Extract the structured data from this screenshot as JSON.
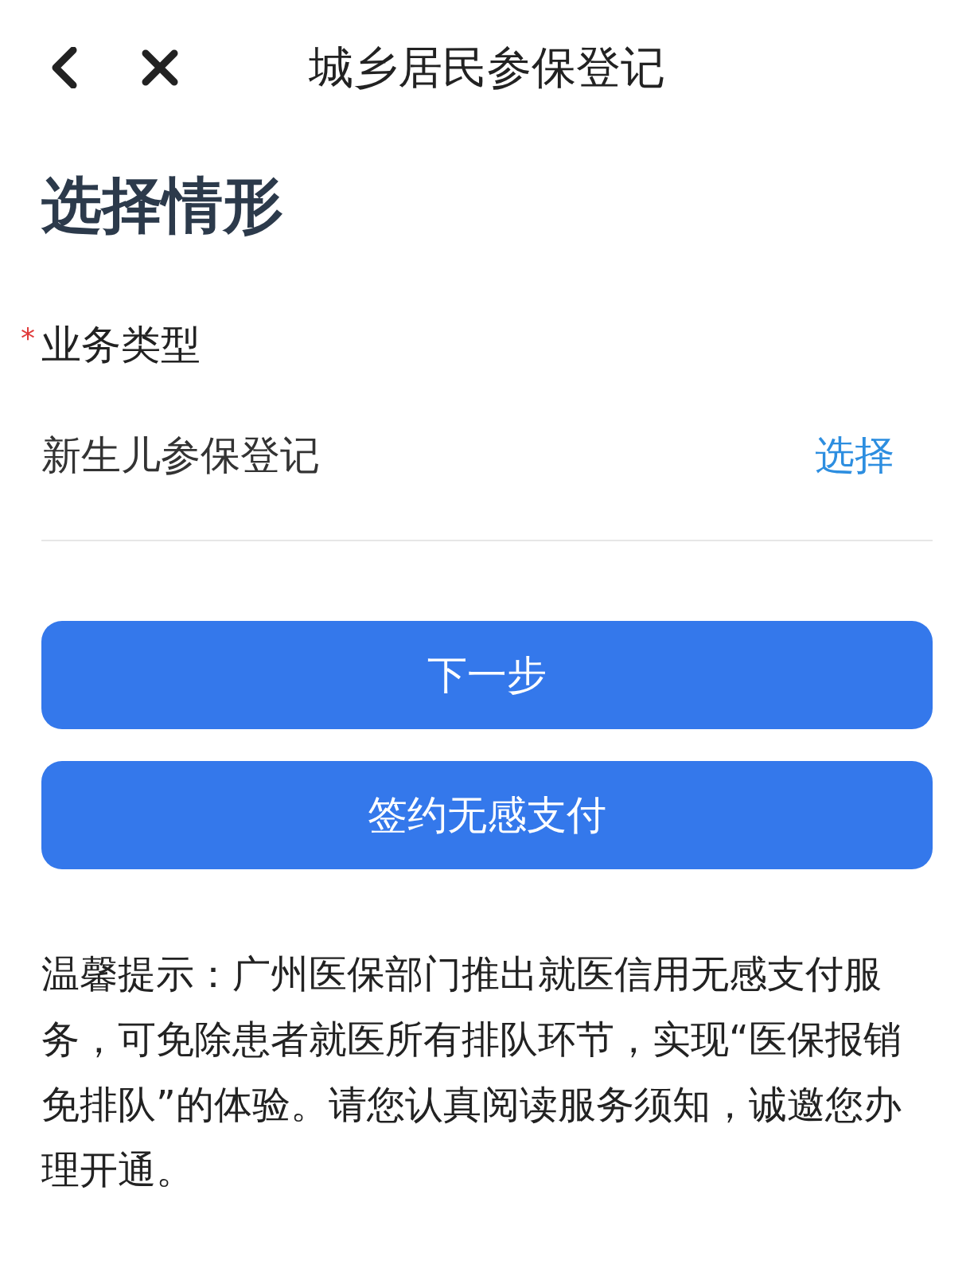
{
  "header": {
    "title": "城乡居民参保登记"
  },
  "heading": "选择情形",
  "field": {
    "required_mark": "*",
    "label": "业务类型",
    "value": "新生儿参保登记",
    "action": "选择"
  },
  "buttons": [
    {
      "label": "下一步"
    },
    {
      "label": "签约无感支付"
    }
  ],
  "notice": "温馨提示：广州医保部门推出就医信用无感支付服务，可免除患者就医所有排队环节，实现“医保报销免排队”的体验。请您认真阅读服务须知，诚邀您办理开通。"
}
